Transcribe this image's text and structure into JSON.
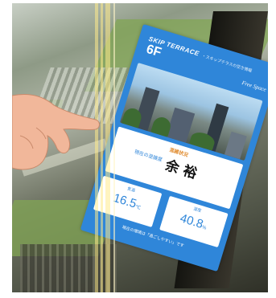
{
  "panel": {
    "title": "SKIP TERRACE",
    "subtitle": "・スキップテラスの空き情報",
    "floor": "6F",
    "space": "Free Space",
    "status_label": "混雑状況",
    "status_sub": "現在の混雑度",
    "status_value": "余 裕",
    "temperature": {
      "label": "気温",
      "value": "16.5",
      "unit": "℃"
    },
    "humidity": {
      "label": "湿度",
      "value": "40.8",
      "unit": "%"
    },
    "note": "現在の環境は「過ごしやすい」です"
  },
  "colors": {
    "panel_blue": "#2f86d9",
    "status_orange": "#e08a2c"
  },
  "icons": [
    "pointing-hand"
  ]
}
